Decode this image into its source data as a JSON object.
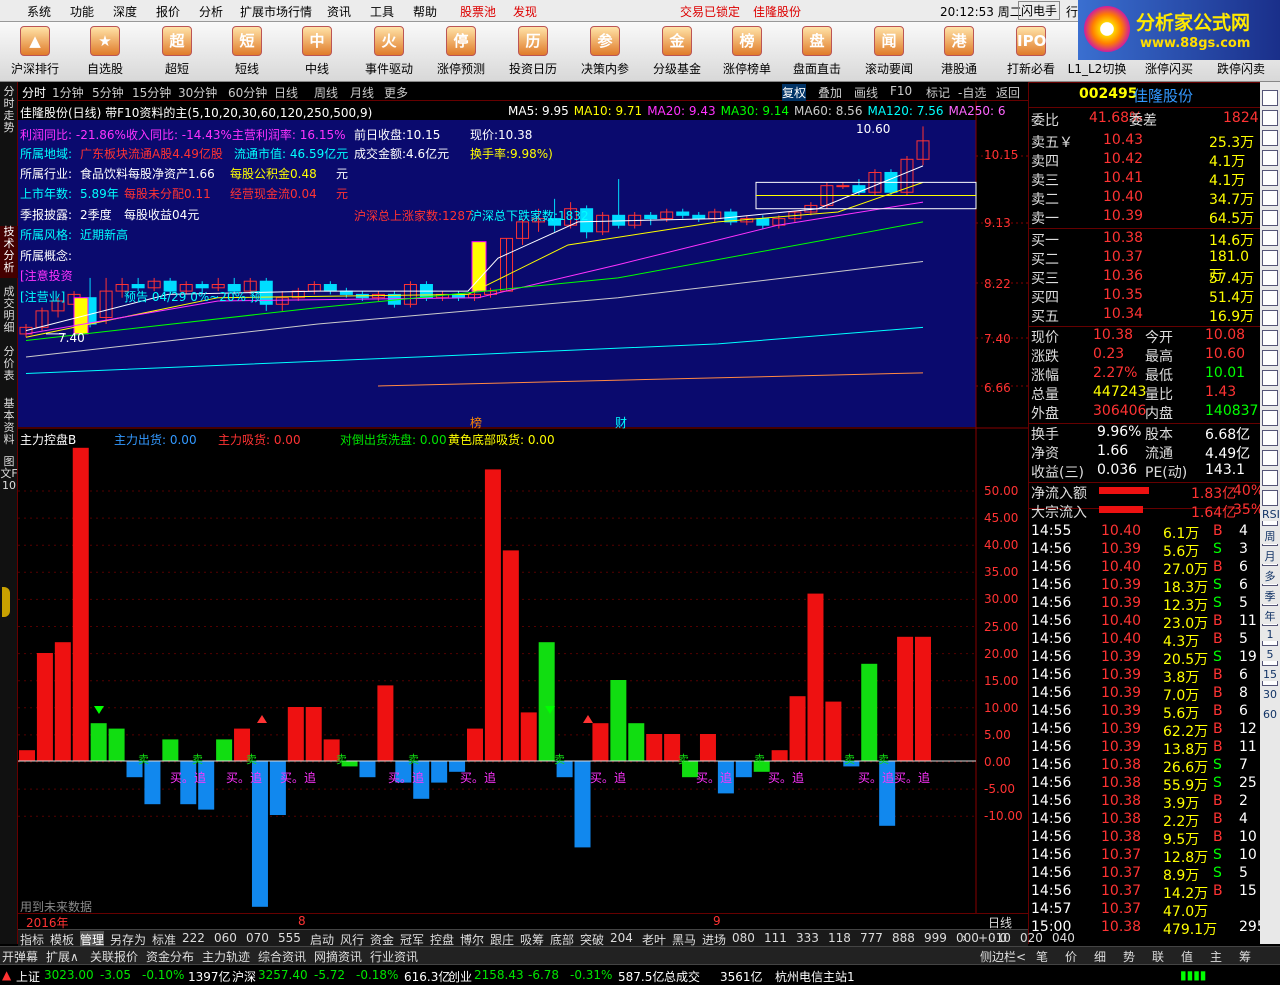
{
  "menu": {
    "items": [
      "系统",
      "功能",
      "深度",
      "报价",
      "分析",
      "扩展市场行情",
      "资讯",
      "工具",
      "帮助",
      "股票池",
      "发现"
    ],
    "notice": "交易已锁定",
    "stock": "佳隆股份",
    "time": "20:12:53 周二",
    "flash": "闪电手",
    "more": "行"
  },
  "logo": {
    "title": "分析家公式网",
    "url": "www.88gs.com"
  },
  "toolbar": [
    "沪深排行",
    "自选股",
    "超短",
    "短线",
    "中线",
    "事件驱动",
    "涨停预测",
    "投资日历",
    "决策内参",
    "分级基金",
    "涨停榜单",
    "盘面直击",
    "滚动要闻",
    "港股通",
    "打新必看",
    "L1_L2切换",
    "涨停闪买",
    "跌停闪卖"
  ],
  "lefttabs": [
    "分时走势",
    "技术分析",
    "成交明细",
    "分价表",
    "基本资料",
    "图文F10"
  ],
  "periods": [
    "分时",
    "1分钟",
    "5分钟",
    "15分钟",
    "30分钟",
    "60分钟",
    "日线",
    "周线",
    "月线",
    "更多"
  ],
  "period_right": [
    "复权",
    "叠加",
    "画线",
    "F10",
    "标记",
    "-自选",
    "返回"
  ],
  "chart_title": "佳隆股份(日线)  带F10资料的主(5,10,20,30,60,120,250,500,9)",
  "ma": [
    {
      "t": "MA5: 9.95",
      "c": "#ffffff"
    },
    {
      "t": "MA10: 9.71",
      "c": "#ffff00"
    },
    {
      "t": "MA20: 9.43",
      "c": "#ff33ff"
    },
    {
      "t": "MA30: 9.14",
      "c": "#00ff00"
    },
    {
      "t": "MA60: 8.56",
      "c": "#cccccc"
    },
    {
      "t": "MA120: 7.56",
      "c": "#00ffff"
    },
    {
      "t": "MA250: 6",
      "c": "#ff66ff"
    }
  ],
  "f10": {
    "l1": "利润同比: -21.86%收入同比: -14.43%主营利润率: 16.15%",
    "prev": "前日收盘:10.15",
    "now": "现价:10.38",
    "l2a": "所属地域:",
    "l2b": "广东板块流通A股4.49亿股",
    "l2c": "流通市值: 46.59亿元",
    "l2d": "成交金额:4.6亿元",
    "l2e": "换手率:9.98%)",
    "l3a": "所属行业:",
    "l3b": "食品饮料每股净资产1.66",
    "l3c": "每股公积金0.48",
    "l3d": "元",
    "l4a": "上市年数:",
    "l4b": "5.89年",
    "l4c": "每股未分配0.11",
    "l4d": "经营现金流0.04",
    "l4e": "元",
    "l5a": "季报披露:",
    "l5b": "2季度",
    "l5c": "每股收益04元",
    "l6a": "所属风格:",
    "l6b": "近期新高",
    "l7": "所属概念:",
    "l8": "[注意投资",
    "l9": "[注营业]",
    "l9b": "预告  04/29 0%~20% 预",
    "zt": "沪深总上涨家数:1287",
    "dt": "沪深总下跌家数:1832",
    "hi": "10.60",
    "lo": "7.40",
    "bang": "榜",
    "cai": "财"
  },
  "price_axis": [
    "10.15",
    "9.13",
    "8.22",
    "7.40",
    "6.66"
  ],
  "ind": {
    "name": "主力控盘B",
    "a": "主力出货: 0.00",
    "b": "主力吸货: 0.00",
    "c": "对倒出货洗盘: 0.00",
    "d": "黄色底部吸货: 0.00",
    "note": "用到未来数据",
    "buy": "买。追",
    "sell": "卖"
  },
  "ind_axis": [
    "50.00",
    "45.00",
    "40.00",
    "35.00",
    "30.00",
    "25.00",
    "20.00",
    "15.00",
    "10.00",
    "5.00",
    "0.00",
    "-5.00",
    "-10.00"
  ],
  "xaxis": {
    "year": "2016年",
    "m8": "8",
    "m9": "9",
    "period": "日线"
  },
  "chart_data": {
    "type": "bar",
    "title": "主力控盘B",
    "values": [
      2,
      20,
      22,
      58,
      7,
      6,
      -3,
      -8,
      4,
      -8,
      -9,
      4,
      6,
      -27,
      -10,
      10,
      10,
      4,
      -1,
      -3,
      14,
      -4,
      -7,
      -4,
      -2,
      6,
      54,
      39,
      9,
      22,
      -3,
      -16,
      7,
      15,
      7,
      5,
      5,
      -3,
      5,
      -6,
      -3,
      -2,
      2,
      12,
      31,
      11,
      -1,
      18,
      -12,
      23,
      23
    ],
    "ylim": [
      -27,
      58
    ]
  },
  "quote": {
    "code": "002495",
    "name": "佳隆股份",
    "wb": "委比",
    "wbv": "41.68%",
    "wc": "委差",
    "wcv": "1824",
    "sell": [
      [
        "卖五￥",
        "10.43",
        "25.3万"
      ],
      [
        "卖四",
        "10.42",
        "4.1万"
      ],
      [
        "卖三",
        "10.41",
        "4.1万"
      ],
      [
        "卖二",
        "10.40",
        "34.7万"
      ],
      [
        "卖一",
        "10.39",
        "64.5万"
      ]
    ],
    "buy": [
      [
        "买一",
        "10.38",
        "14.6万"
      ],
      [
        "买二",
        "10.37",
        "181.0万"
      ],
      [
        "买三",
        "10.36",
        "57.4万"
      ],
      [
        "买四",
        "10.35",
        "51.4万"
      ],
      [
        "买五",
        "10.34",
        "16.9万"
      ]
    ],
    "stats": [
      [
        "现价",
        "10.38",
        "今开",
        "10.08"
      ],
      [
        "涨跌",
        "0.23",
        "最高",
        "10.60"
      ],
      [
        "涨幅",
        "2.27%",
        "最低",
        "10.01"
      ],
      [
        "总量",
        "447243",
        "量比",
        "1.43"
      ],
      [
        "外盘",
        "306406",
        "内盘",
        "140837"
      ]
    ],
    "stats2": [
      [
        "换手",
        "9.96%",
        "股本",
        "6.68亿"
      ],
      [
        "净资",
        "1.66",
        "流通",
        "4.49亿"
      ],
      [
        "收益(三)",
        "0.036",
        "PE(动)",
        "143.1"
      ]
    ],
    "flow": [
      [
        "净流入额",
        "1.83亿",
        "40%"
      ],
      [
        "大宗流入",
        "1.64亿",
        "35%"
      ]
    ]
  },
  "ticks": [
    [
      "14:55",
      "10.40",
      "6.1万",
      "B",
      "4"
    ],
    [
      "14:56",
      "10.39",
      "5.6万",
      "S",
      "3"
    ],
    [
      "14:56",
      "10.40",
      "27.0万",
      "B",
      "6"
    ],
    [
      "14:56",
      "10.39",
      "18.3万",
      "S",
      "6"
    ],
    [
      "14:56",
      "10.39",
      "12.3万",
      "S",
      "5"
    ],
    [
      "14:56",
      "10.40",
      "23.0万",
      "B",
      "11"
    ],
    [
      "14:56",
      "10.40",
      "4.3万",
      "B",
      "5"
    ],
    [
      "14:56",
      "10.39",
      "20.5万",
      "S",
      "19"
    ],
    [
      "14:56",
      "10.39",
      "3.8万",
      "B",
      "6"
    ],
    [
      "14:56",
      "10.39",
      "7.0万",
      "B",
      "8"
    ],
    [
      "14:56",
      "10.39",
      "5.6万",
      "B",
      "6"
    ],
    [
      "14:56",
      "10.39",
      "62.2万",
      "B",
      "12"
    ],
    [
      "14:56",
      "10.39",
      "13.8万",
      "B",
      "11"
    ],
    [
      "14:56",
      "10.38",
      "26.6万",
      "S",
      "7"
    ],
    [
      "14:56",
      "10.38",
      "55.9万",
      "S",
      "25"
    ],
    [
      "14:56",
      "10.38",
      "3.9万",
      "B",
      "2"
    ],
    [
      "14:56",
      "10.38",
      "2.2万",
      "B",
      "4"
    ],
    [
      "14:56",
      "10.38",
      "9.5万",
      "B",
      "10"
    ],
    [
      "14:56",
      "10.37",
      "12.8万",
      "S",
      "10"
    ],
    [
      "14:56",
      "10.37",
      "8.9万",
      "S",
      "5"
    ],
    [
      "14:56",
      "10.37",
      "14.2万",
      "B",
      "15"
    ],
    [
      "14:57",
      "10.37",
      "47.0万",
      "",
      ""
    ],
    [
      "15:00",
      "10.38",
      "479.1万",
      "",
      "295"
    ]
  ],
  "bottom_tabs": [
    "指标",
    "模板",
    "管理",
    "另存为",
    "标准",
    "222",
    "060",
    "070",
    "555",
    "启动",
    "风行",
    "资金",
    "冠军",
    "控盘",
    "博尔",
    "跟庄",
    "吸筹",
    "底部",
    "突破",
    "204",
    "老叶",
    "黑马",
    "进场",
    "080",
    "111",
    "333",
    "118",
    "777",
    "888",
    "999",
    "000",
    "010",
    "020",
    "040"
  ],
  "bottom_tabs2": [
    "开弹幕",
    "扩展∧",
    "关联报价",
    "资金分布",
    "主力轨迹",
    "综合资讯",
    "网摘资讯",
    "行业资讯"
  ],
  "side_label": "侧边栏<",
  "rtabs": [
    "笔",
    "价",
    "细",
    "势",
    "联",
    "值",
    "主",
    "筹"
  ],
  "status": {
    "sh": "上证",
    "shv": "3023.00",
    "shc": "-3.05",
    "shp": "-0.10%",
    "shm": "1397亿",
    "hs": "沪深",
    "hsv": "3257.40",
    "hsc": "-5.72",
    "hsp": "-0.18%",
    "hsm": "616.3亿",
    "cy": "创业",
    "cyv": "2158.43",
    "cyc": "-6.78",
    "cyp": "-0.31%",
    "cym": "587.5亿",
    "total": "总成交",
    "totalv": "3561亿",
    "server": "杭州电信主站1"
  },
  "rtool": [
    "RSI",
    "周",
    "月",
    "多",
    "季",
    "年",
    "1",
    "5",
    "15",
    "30",
    "60"
  ]
}
